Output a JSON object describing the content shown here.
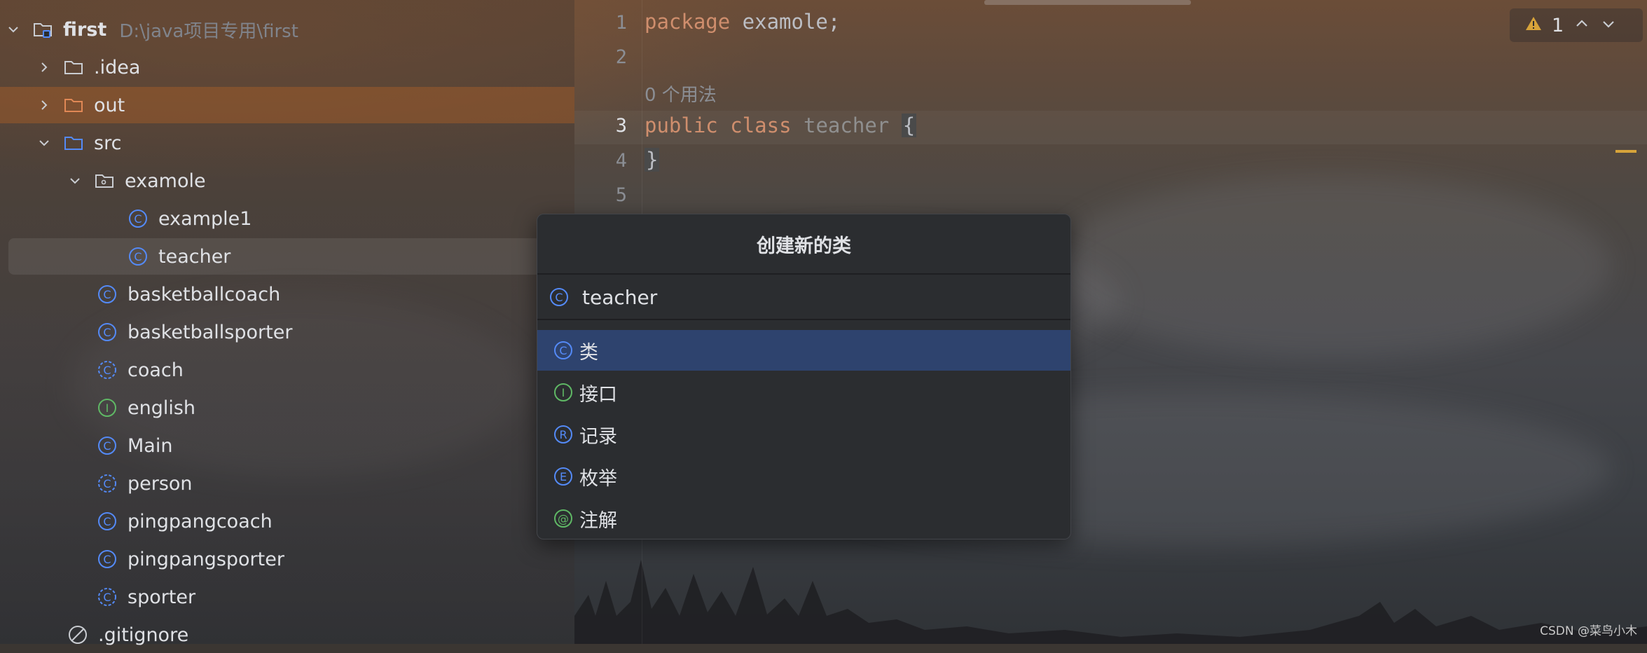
{
  "project_tree": {
    "root": {
      "name": "first",
      "path": "D:\\java项目专用\\first"
    },
    "items": [
      {
        "label": ".idea",
        "icon": "folder-icon"
      },
      {
        "label": "out",
        "icon": "folder-orange-icon"
      },
      {
        "label": "src",
        "icon": "source-folder-icon"
      },
      {
        "label": "examole",
        "icon": "package-icon"
      },
      {
        "label": "example1",
        "icon": "class-icon"
      },
      {
        "label": "teacher",
        "icon": "class-icon"
      },
      {
        "label": "basketballcoach",
        "icon": "class-icon"
      },
      {
        "label": "basketballsporter",
        "icon": "class-icon"
      },
      {
        "label": "coach",
        "icon": "abstract-class-icon"
      },
      {
        "label": "english",
        "icon": "interface-icon"
      },
      {
        "label": "Main",
        "icon": "class-icon"
      },
      {
        "label": "person",
        "icon": "abstract-class-icon"
      },
      {
        "label": "pingpangcoach",
        "icon": "class-icon"
      },
      {
        "label": "pingpangsporter",
        "icon": "class-icon"
      },
      {
        "label": "sporter",
        "icon": "abstract-class-icon"
      },
      {
        "label": ".gitignore",
        "icon": "ignored-file-icon"
      }
    ]
  },
  "editor": {
    "line_numbers": [
      "1",
      "2",
      "3",
      "4",
      "5"
    ],
    "line1": {
      "kw": "package",
      "rest": " examole;"
    },
    "usage_hint": "0 个用法",
    "line3": {
      "kw1": "public",
      "kw2": "class",
      "name": "teacher",
      "brace": "{"
    },
    "line4": "}",
    "inspections": {
      "count": "1",
      "icon": "warning-icon"
    }
  },
  "dialog": {
    "title": "创建新的类",
    "input_value": "teacher",
    "options": [
      {
        "label": "类",
        "icon": "class-icon",
        "letter": "C"
      },
      {
        "label": "接口",
        "icon": "interface-icon",
        "letter": "I"
      },
      {
        "label": "记录",
        "icon": "record-icon",
        "letter": "R"
      },
      {
        "label": "枚举",
        "icon": "enum-icon",
        "letter": "E"
      },
      {
        "label": "注解",
        "icon": "annotation-icon",
        "letter": "@"
      }
    ]
  },
  "watermark": "CSDN @菜鸟小木",
  "colors": {
    "accent_blue": "#548af7",
    "interface_green": "#5fb865",
    "selection": "#2e436e",
    "keyword": "#cf8e6d",
    "warning": "#d7a33a"
  }
}
